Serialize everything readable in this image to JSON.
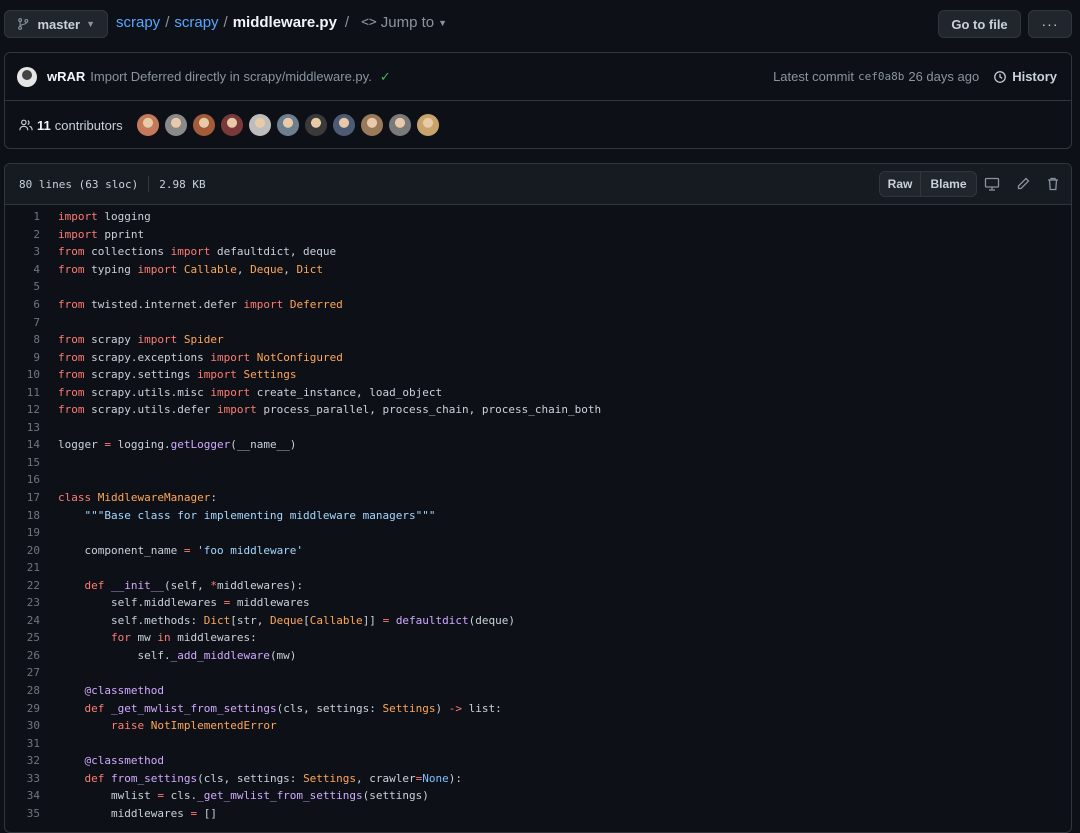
{
  "breadcrumb": {
    "branch": "master",
    "repo_owner": "scrapy",
    "repo_name": "scrapy",
    "file_name": "middleware.py",
    "jump_to": "Jump to",
    "separator": "/"
  },
  "actions": {
    "go_to_file": "Go to file",
    "more": "···"
  },
  "commit": {
    "author": "wRAR",
    "message": "Import Deferred directly in scrapy/middleware.py.",
    "latest_label": "Latest commit",
    "sha": "cef0a8b",
    "age": "26 days ago",
    "history_label": "History"
  },
  "contributors": {
    "count": "11",
    "label": "contributors",
    "avatar_colors": [
      "#c47a5a",
      "#8a8a8a",
      "#a35b3a",
      "#7a3a3a",
      "#bdbdbd",
      "#6d7f8f",
      "#3a3a3a",
      "#4d5a73",
      "#9a7a5a",
      "#7a7a7a",
      "#c9a46a"
    ]
  },
  "file": {
    "lines_info": "80 lines (63 sloc)",
    "size": "2.98 KB",
    "raw_label": "Raw",
    "blame_label": "Blame"
  },
  "code_lines": [
    [
      [
        "k",
        "import"
      ],
      [
        "t",
        " logging"
      ]
    ],
    [
      [
        "k",
        "import"
      ],
      [
        "t",
        " pprint"
      ]
    ],
    [
      [
        "k",
        "from"
      ],
      [
        "t",
        " collections "
      ],
      [
        "k",
        "import"
      ],
      [
        "t",
        " defaultdict, deque"
      ]
    ],
    [
      [
        "k",
        "from"
      ],
      [
        "t",
        " typing "
      ],
      [
        "k",
        "import"
      ],
      [
        "t",
        " "
      ],
      [
        "c",
        "Callable"
      ],
      [
        "t",
        ", "
      ],
      [
        "c",
        "Deque"
      ],
      [
        "t",
        ", "
      ],
      [
        "c",
        "Dict"
      ]
    ],
    [],
    [
      [
        "k",
        "from"
      ],
      [
        "t",
        " twisted.internet.defer "
      ],
      [
        "k",
        "import"
      ],
      [
        "t",
        " "
      ],
      [
        "c",
        "Deferred"
      ]
    ],
    [],
    [
      [
        "k",
        "from"
      ],
      [
        "t",
        " scrapy "
      ],
      [
        "k",
        "import"
      ],
      [
        "t",
        " "
      ],
      [
        "c",
        "Spider"
      ]
    ],
    [
      [
        "k",
        "from"
      ],
      [
        "t",
        " scrapy.exceptions "
      ],
      [
        "k",
        "import"
      ],
      [
        "t",
        " "
      ],
      [
        "c",
        "NotConfigured"
      ]
    ],
    [
      [
        "k",
        "from"
      ],
      [
        "t",
        " scrapy.settings "
      ],
      [
        "k",
        "import"
      ],
      [
        "t",
        " "
      ],
      [
        "c",
        "Settings"
      ]
    ],
    [
      [
        "k",
        "from"
      ],
      [
        "t",
        " scrapy.utils.misc "
      ],
      [
        "k",
        "import"
      ],
      [
        "t",
        " create_instance, load_object"
      ]
    ],
    [
      [
        "k",
        "from"
      ],
      [
        "t",
        " scrapy.utils.defer "
      ],
      [
        "k",
        "import"
      ],
      [
        "t",
        " process_parallel, process_chain, process_chain_both"
      ]
    ],
    [],
    [
      [
        "t",
        "logger "
      ],
      [
        "o",
        "="
      ],
      [
        "t",
        " logging."
      ],
      [
        "f",
        "getLogger"
      ],
      [
        "t",
        "(__name__)"
      ]
    ],
    [],
    [],
    [
      [
        "k",
        "class"
      ],
      [
        "t",
        " "
      ],
      [
        "c",
        "MiddlewareManager"
      ],
      [
        "t",
        ":"
      ]
    ],
    [
      [
        "t",
        "    "
      ],
      [
        "s",
        "\"\"\"Base class for implementing middleware managers\"\"\""
      ]
    ],
    [],
    [
      [
        "t",
        "    component_name "
      ],
      [
        "o",
        "="
      ],
      [
        "t",
        " "
      ],
      [
        "s",
        "'foo middleware'"
      ]
    ],
    [],
    [
      [
        "t",
        "    "
      ],
      [
        "k",
        "def"
      ],
      [
        "t",
        " "
      ],
      [
        "f",
        "__init__"
      ],
      [
        "t",
        "(self, "
      ],
      [
        "o",
        "*"
      ],
      [
        "t",
        "middlewares):"
      ]
    ],
    [
      [
        "t",
        "        self.middlewares "
      ],
      [
        "o",
        "="
      ],
      [
        "t",
        " middlewares"
      ]
    ],
    [
      [
        "t",
        "        self.methods: "
      ],
      [
        "c",
        "Dict"
      ],
      [
        "t",
        "[str, "
      ],
      [
        "c",
        "Deque"
      ],
      [
        "t",
        "["
      ],
      [
        "c",
        "Callable"
      ],
      [
        "t",
        "]] "
      ],
      [
        "o",
        "="
      ],
      [
        "t",
        " "
      ],
      [
        "f",
        "defaultdict"
      ],
      [
        "t",
        "(deque)"
      ]
    ],
    [
      [
        "t",
        "        "
      ],
      [
        "k",
        "for"
      ],
      [
        "t",
        " mw "
      ],
      [
        "k",
        "in"
      ],
      [
        "t",
        " middlewares:"
      ]
    ],
    [
      [
        "t",
        "            self."
      ],
      [
        "f",
        "_add_middleware"
      ],
      [
        "t",
        "(mw)"
      ]
    ],
    [],
    [
      [
        "t",
        "    "
      ],
      [
        "d",
        "@classmethod"
      ]
    ],
    [
      [
        "t",
        "    "
      ],
      [
        "k",
        "def"
      ],
      [
        "t",
        " "
      ],
      [
        "f",
        "_get_mwlist_from_settings"
      ],
      [
        "t",
        "(cls, settings: "
      ],
      [
        "c",
        "Settings"
      ],
      [
        "t",
        ") "
      ],
      [
        "o",
        "->"
      ],
      [
        "t",
        " list:"
      ]
    ],
    [
      [
        "t",
        "        "
      ],
      [
        "k",
        "raise"
      ],
      [
        "t",
        " "
      ],
      [
        "c",
        "NotImplementedError"
      ]
    ],
    [],
    [
      [
        "t",
        "    "
      ],
      [
        "d",
        "@classmethod"
      ]
    ],
    [
      [
        "t",
        "    "
      ],
      [
        "k",
        "def"
      ],
      [
        "t",
        " "
      ],
      [
        "f",
        "from_settings"
      ],
      [
        "t",
        "(cls, settings: "
      ],
      [
        "c",
        "Settings"
      ],
      [
        "t",
        ", crawler"
      ],
      [
        "o",
        "="
      ],
      [
        "b",
        "None"
      ],
      [
        "t",
        "):"
      ]
    ],
    [
      [
        "t",
        "        mwlist "
      ],
      [
        "o",
        "="
      ],
      [
        "t",
        " cls."
      ],
      [
        "f",
        "_get_mwlist_from_settings"
      ],
      [
        "t",
        "(settings)"
      ]
    ],
    [
      [
        "t",
        "        middlewares "
      ],
      [
        "o",
        "="
      ],
      [
        "t",
        " []"
      ]
    ]
  ]
}
